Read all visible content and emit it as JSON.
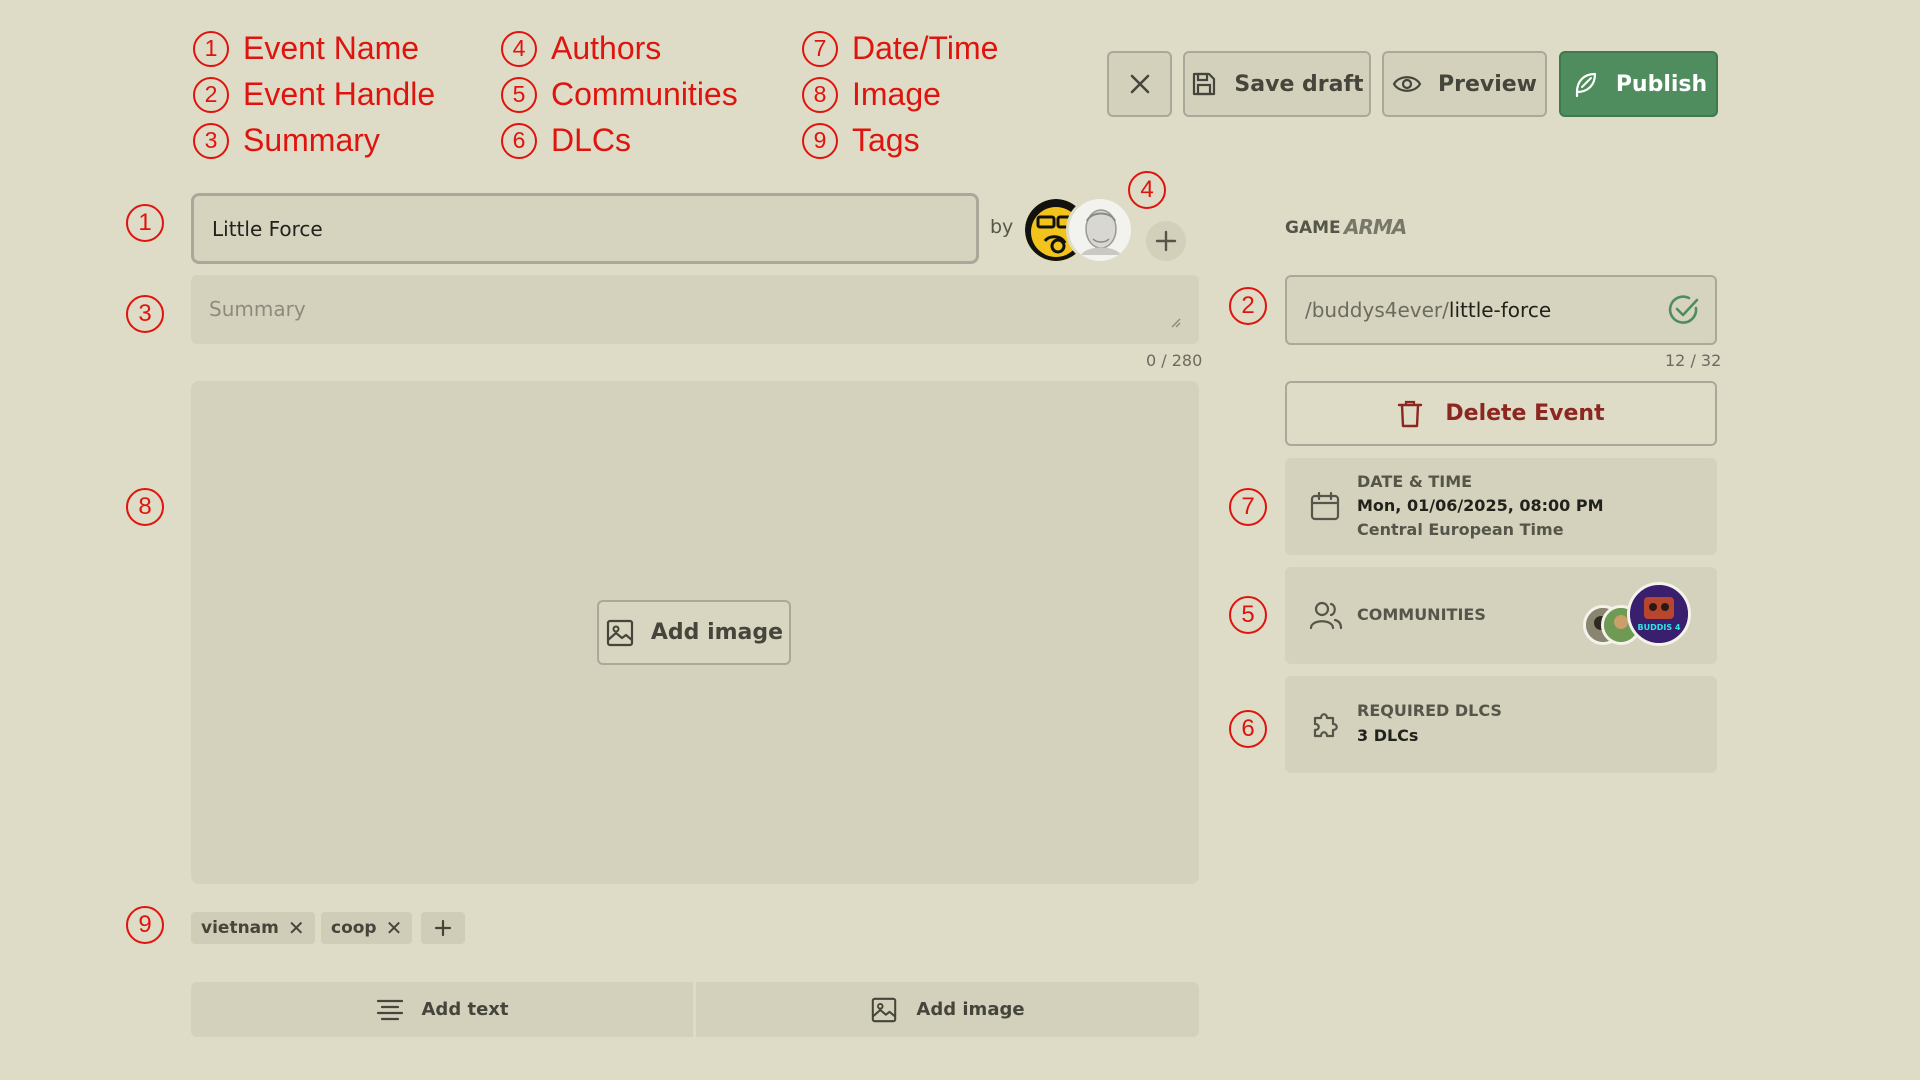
{
  "legend": [
    {
      "num": "1",
      "label": "Event Name"
    },
    {
      "num": "2",
      "label": "Event Handle"
    },
    {
      "num": "3",
      "label": "Summary"
    },
    {
      "num": "4",
      "label": "Authors"
    },
    {
      "num": "5",
      "label": "Communities"
    },
    {
      "num": "6",
      "label": "DLCs"
    },
    {
      "num": "7",
      "label": "Date/Time"
    },
    {
      "num": "8",
      "label": "Image"
    },
    {
      "num": "9",
      "label": "Tags"
    }
  ],
  "toolbar": {
    "close_icon": "close-icon",
    "save_draft": "Save draft",
    "preview": "Preview",
    "publish": "Publish",
    "publish_color": "#4f8d5e"
  },
  "event": {
    "name": "Little Force",
    "by_label": "by",
    "summary_placeholder": "Summary",
    "summary_counter": "0 / 280",
    "add_image": "Add image"
  },
  "tags": [
    {
      "label": "vietnam"
    },
    {
      "label": "coop"
    }
  ],
  "bottom_bar": {
    "add_text": "Add text",
    "add_image": "Add image"
  },
  "sidebar": {
    "game_label": "GAME",
    "game_logo": "ARMA",
    "handle_prefix": "/buddys4ever/",
    "handle_slug": "little-force",
    "handle_counter": "12 / 32",
    "delete_event": "Delete Event",
    "date_time": {
      "caption": "DATE & TIME",
      "value": "Mon, 01/06/2025, 08:00 PM",
      "timezone": "Central European Time"
    },
    "communities": {
      "caption": "COMMUNITIES",
      "featured_badge": "BUDDIS 4"
    },
    "dlcs": {
      "caption": "REQUIRED DLCS",
      "value": "3 DLCs"
    }
  },
  "colors": {
    "background": "#dedcc6",
    "annotation": "#e0140e",
    "danger": "#8c2620",
    "success": "#4f8d5e"
  }
}
